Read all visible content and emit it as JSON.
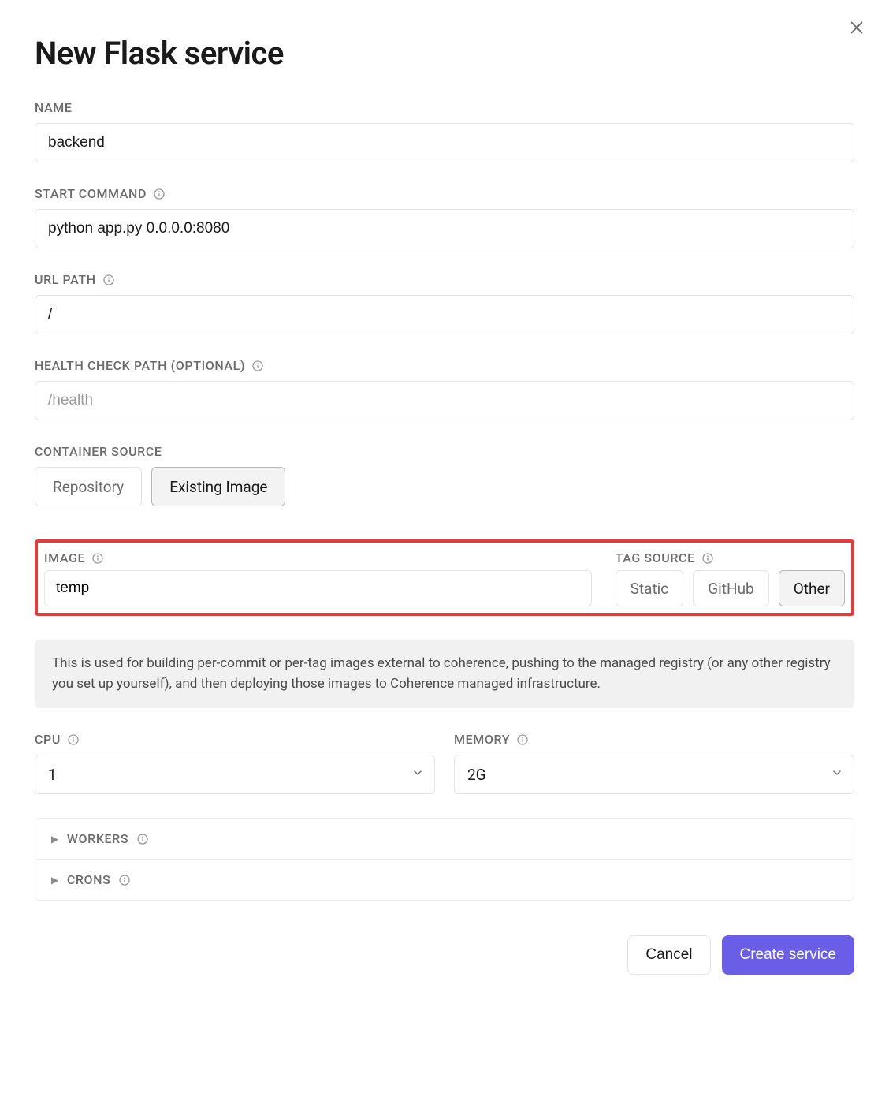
{
  "title": "New Flask service",
  "labels": {
    "name": "NAME",
    "start_command": "START COMMAND",
    "url_path": "URL PATH",
    "health_check": "HEALTH CHECK PATH (OPTIONAL)",
    "container_source": "CONTAINER SOURCE",
    "image": "IMAGE",
    "tag_source": "TAG SOURCE",
    "cpu": "CPU",
    "memory": "MEMORY",
    "workers": "WORKERS",
    "crons": "CRONS"
  },
  "values": {
    "name": "backend",
    "start_command": "python app.py 0.0.0.0:8080",
    "url_path": "/",
    "health_check": "",
    "health_check_placeholder": "/health",
    "image": "temp",
    "cpu": "1",
    "memory": "2G"
  },
  "container_source": {
    "options": [
      "Repository",
      "Existing Image"
    ],
    "selected": "Existing Image"
  },
  "tag_source": {
    "options": [
      "Static",
      "GitHub",
      "Other"
    ],
    "selected": "Other"
  },
  "info_banner": "This is used for building per-commit or per-tag images external to coherence, pushing to the managed registry (or any other registry you set up yourself), and then deploying those images to Coherence managed infrastructure.",
  "buttons": {
    "cancel": "Cancel",
    "create": "Create service"
  }
}
